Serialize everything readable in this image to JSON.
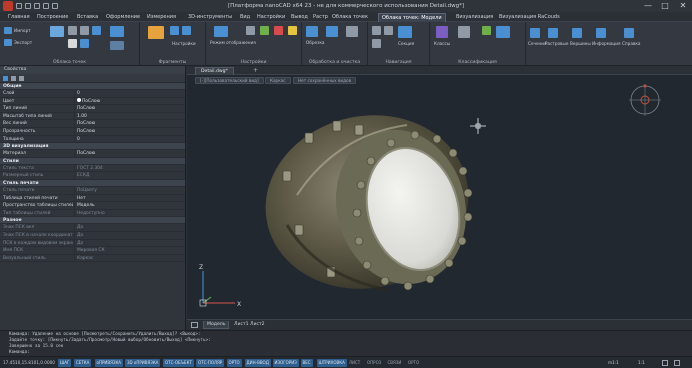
{
  "window": {
    "title": "[Платформа nanoCAD x64 23 - не для коммерческого использования Detail.dwg*]",
    "minimize": "—",
    "maximize": "□",
    "close": "✕"
  },
  "menu": {
    "tabs": [
      "Главная",
      "Построение",
      "Вставка",
      "Оформление",
      "Измерения",
      "3D-инструменты",
      "Вид",
      "Настройки",
      "Вывод",
      "Растр",
      "Облака точек",
      "Облака точек: Модели",
      "Визуализация",
      "Визуализация RaCouds"
    ],
    "active_index": 11
  },
  "ribbon": {
    "groups": [
      {
        "label": "Облака точек",
        "buttons": [
          "Импорт",
          "Экспорт",
          "Облако",
          "Ограничения",
          "Ракурс",
          "Закр.",
          "Уровень"
        ]
      },
      {
        "label": "Фрагменты",
        "buttons": [
          "Фрагменты",
          "Построить",
          "Настройки"
        ]
      },
      {
        "label": "Настройки",
        "buttons": [
          "Режим отображения",
          "Размер точки",
          "Видимость"
        ]
      },
      {
        "label": "Обработка и очистка",
        "buttons": [
          "Обрезка",
          "Прореживание",
          "Выделение"
        ]
      },
      {
        "label": "Навигация",
        "buttons": [
          "Секция",
          "Выделение",
          "Скан"
        ]
      },
      {
        "label": "Классификация",
        "buttons": [
          "Классы",
          "Выбор",
          "Отобразить"
        ]
      },
      {
        "label": "",
        "buttons": [
          "Сечения",
          "Растровые",
          "Вершины",
          "Информация",
          "Справка"
        ]
      }
    ]
  },
  "properties": {
    "header": "Свойства",
    "rows": [
      {
        "type": "section",
        "label": "Общие"
      },
      {
        "name": "Слой",
        "value": "0"
      },
      {
        "name": "Цвет",
        "value": "ПоСлою"
      },
      {
        "name": "Тип линий",
        "value": "ПоСлою"
      },
      {
        "name": "Масштаб типа линий",
        "value": "1.00"
      },
      {
        "name": "Вес линий",
        "value": "ПоСлою"
      },
      {
        "name": "Прозрачность",
        "value": "ПоСлою"
      },
      {
        "name": "Толщина",
        "value": "0"
      },
      {
        "type": "section",
        "label": "3D визуализация"
      },
      {
        "name": "Материал",
        "value": "ПоСлою"
      },
      {
        "type": "section",
        "label": "Стили"
      },
      {
        "name": "Стиль текста",
        "value": "ГОСТ 2.304",
        "dim": true
      },
      {
        "name": "Размерный стиль",
        "value": "ЕСКД",
        "dim": true
      },
      {
        "type": "section",
        "label": "Стиль печати"
      },
      {
        "name": "Стиль печати",
        "value": "ПоЦвету",
        "dim": true
      },
      {
        "name": "Таблица стилей печати",
        "value": "Нет"
      },
      {
        "name": "Пространство таблицы стилей печати",
        "value": "Модель"
      },
      {
        "name": "Тип таблицы стилей",
        "value": "Недоступно",
        "dim": true
      },
      {
        "type": "section",
        "label": "Разное"
      },
      {
        "name": "Знак ПСК вкл",
        "value": "Да",
        "dim": true
      },
      {
        "name": "Знак ПСК в начале координат",
        "value": "Да",
        "dim": true
      },
      {
        "name": "ПСК в каждом видовом экране",
        "value": "Да",
        "dim": true
      },
      {
        "name": "Имя ПСК",
        "value": "Мировая СК",
        "dim": true
      },
      {
        "name": "Визуальный стиль",
        "value": "Каркас",
        "dim": true
      }
    ]
  },
  "document": {
    "tab_label": "Detail.dwg*",
    "add_label": "+",
    "view_chips": [
      "[-][Пользовательский вид]",
      "Каркас",
      "Нет сохранённых видов"
    ]
  },
  "layout_tabs": [
    "Модель",
    "Лист1",
    "Лист2"
  ],
  "command_line": [
    "Команда:  Удаление на основе [Посмотреть/Сохранить/Удалить/Выход]? <Выход>:",
    "Задайте точку: [Пикнуть/Задать/Просмотр/Новый выбор/Обновить/Выход] <Пикнуть>:",
    "Завершено за 15.0 сек",
    "Команда:"
  ],
  "status_bar": {
    "coords": "17.4510,15.8101,0.0000",
    "buttons": [
      "ШАГ",
      "СЕТКА",
      "оПРИВЯЗКА",
      "3D оПРИВЯЗКА",
      "ОТС-ОБЪЕКТ",
      "ОТС-ПОЛЯР",
      "ОРТО",
      "ДИН-ВВОД",
      "ИЗОГОРИЗ",
      "ВЕС",
      "ШТРИХОВКА",
      "ЛИСТ",
      "ОПРОЗ",
      "СВЯЗИ",
      "ОРТО"
    ],
    "scale": "m1:1",
    "zoom": "1:1"
  },
  "colors": {
    "accent": "#2f5f8e",
    "viewport": "#212830",
    "ribbon": "#343941"
  }
}
